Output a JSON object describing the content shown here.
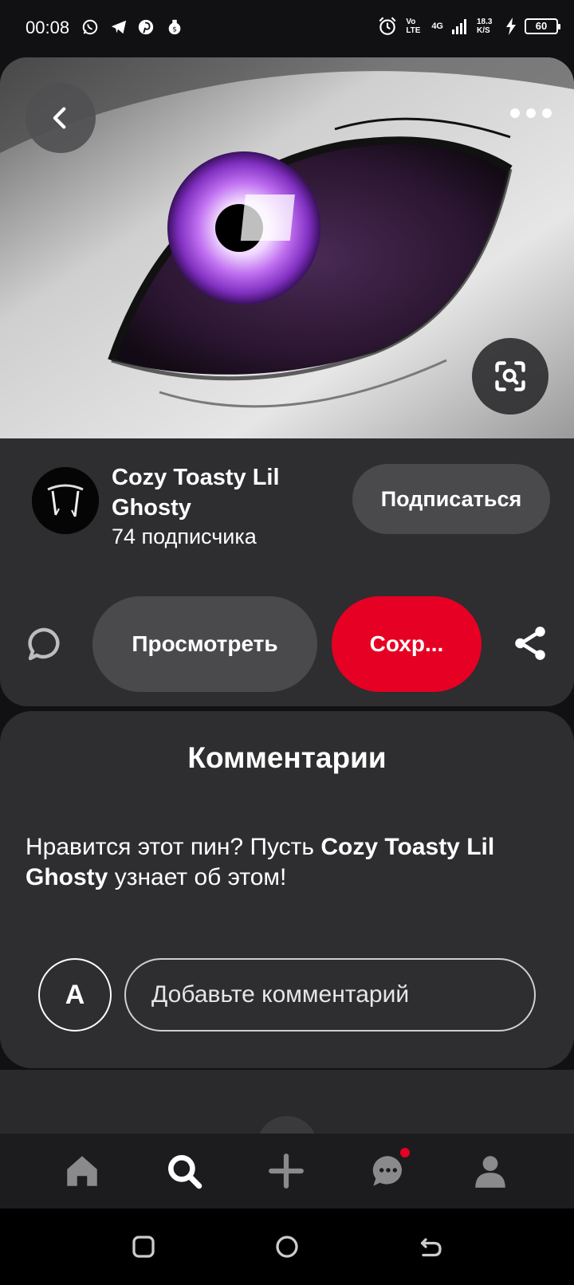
{
  "status_bar": {
    "time": "00:08",
    "network_label": "Vo LTE",
    "signal_label": "4G",
    "speed_label": "18.3 K/S",
    "battery": "60"
  },
  "pin": {
    "image_description_icon": "purple-eye-image",
    "back_icon": "chevron-left-icon",
    "more_icon": "more-dots-icon",
    "lens_icon": "visual-search-icon"
  },
  "author": {
    "name": "Cozy Toasty Lil Ghosty",
    "followers": "74 подписчика",
    "follow_label": "Подписаться"
  },
  "actions": {
    "view_label": "Просмотреть",
    "save_label": "Сохр...",
    "comment_icon": "comment-bubble-icon",
    "share_icon": "share-icon"
  },
  "comments": {
    "title": "Комментарии",
    "prompt_before": "Нравится этот пин? Пусть ",
    "prompt_name": "Cozy Toasty Lil Ghosty",
    "prompt_after": " узнает об этом!",
    "user_initial": "A",
    "input_placeholder": "Добавьте комментарий"
  },
  "bottom_nav": {
    "items": [
      "home-icon",
      "search-icon",
      "create-icon",
      "messages-icon",
      "profile-icon"
    ],
    "active": "search-icon"
  },
  "colors": {
    "accent_red": "#e60023",
    "card_bg": "#2e2d30",
    "button_bg": "#4a494c"
  }
}
